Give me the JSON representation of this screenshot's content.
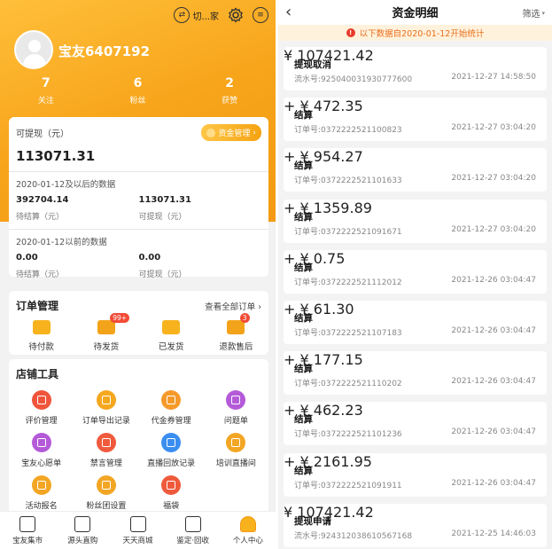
{
  "left": {
    "header": {
      "switch_label": "切...家"
    },
    "user": {
      "name": "宝友6407192"
    },
    "stats": [
      {
        "value": "7",
        "label": "关注"
      },
      {
        "value": "6",
        "label": "粉丝"
      },
      {
        "value": "2",
        "label": "获赞"
      }
    ],
    "wallet": {
      "withdrawable_label": "可提现（元）",
      "fund_manage_label": "资金管理",
      "withdrawable_amount": "113071.31",
      "after_label": "2020-01-12及以后的数据",
      "after_pending_value": "392704.14",
      "after_pending_label": "待结算（元）",
      "after_withdrawable_value": "113071.31",
      "after_withdrawable_label": "可提现（元）",
      "before_label": "2020-01-12以前的数据",
      "before_pending_value": "0.00",
      "before_pending_label": "待结算（元）",
      "before_withdrawable_value": "0.00",
      "before_withdrawable_label": "可提现（元）"
    },
    "orders": {
      "title": "订单管理",
      "view_all": "查看全部订单",
      "items": [
        {
          "label": "待付款",
          "badge": ""
        },
        {
          "label": "待发货",
          "badge": "99+"
        },
        {
          "label": "已发货",
          "badge": ""
        },
        {
          "label": "退款售后",
          "badge": "3"
        }
      ]
    },
    "tools": {
      "title": "店铺工具",
      "items": [
        {
          "label": "评价管理",
          "color": "#f0553c"
        },
        {
          "label": "订单导出记录",
          "color": "#f5a71e"
        },
        {
          "label": "代金券管理",
          "color": "#f59a2a"
        },
        {
          "label": "问题单",
          "color": "#b45ad8"
        },
        {
          "label": "宝友心愿单",
          "color": "#b45ad8"
        },
        {
          "label": "禁言管理",
          "color": "#ef5a3c"
        },
        {
          "label": "直播回放记录",
          "color": "#3b8ef0"
        },
        {
          "label": "培训直播间",
          "color": "#f2a624"
        },
        {
          "label": "活动报名",
          "color": "#f2a624"
        },
        {
          "label": "粉丝团设置",
          "color": "#f2a624"
        },
        {
          "label": "福袋",
          "color": "#ef5a3c"
        }
      ]
    },
    "tabs": [
      {
        "label": "宝友集市"
      },
      {
        "label": "源头直购"
      },
      {
        "label": "天天商城"
      },
      {
        "label": "鉴定·回收"
      },
      {
        "label": "个人中心"
      }
    ]
  },
  "right": {
    "title": "资金明细",
    "back_icon": "‹",
    "filter_label": "筛选",
    "notice": "以下数据自2020-01-12开始统计",
    "transactions": [
      {
        "name": "提现取消",
        "serial": "流水号:925040031930777600",
        "amount": "¥ 107421.42",
        "time": "2021-12-27 14:58:50"
      },
      {
        "name": "结算",
        "serial": "订单号:0372222521100823",
        "amount": "+ ¥ 472.35",
        "time": "2021-12-27 03:04:20"
      },
      {
        "name": "结算",
        "serial": "订单号:0372222521101633",
        "amount": "+ ¥ 954.27",
        "time": "2021-12-27 03:04:20"
      },
      {
        "name": "结算",
        "serial": "订单号:0372222521091671",
        "amount": "+ ¥ 1359.89",
        "time": "2021-12-27 03:04:20"
      },
      {
        "name": "结算",
        "serial": "订单号:0372222521112012",
        "amount": "+ ¥ 0.75",
        "time": "2021-12-26 03:04:47"
      },
      {
        "name": "结算",
        "serial": "订单号:0372222521107183",
        "amount": "+ ¥ 61.30",
        "time": "2021-12-26 03:04:47"
      },
      {
        "name": "结算",
        "serial": "订单号:0372222521110202",
        "amount": "+ ¥ 177.15",
        "time": "2021-12-26 03:04:47"
      },
      {
        "name": "结算",
        "serial": "订单号:0372222521101236",
        "amount": "+ ¥ 462.23",
        "time": "2021-12-26 03:04:47"
      },
      {
        "name": "结算",
        "serial": "订单号:0372222521091911",
        "amount": "+ ¥ 2161.95",
        "time": "2021-12-26 03:04:47"
      },
      {
        "name": "提现申请",
        "serial": "流水号:924312038610567168",
        "amount": "¥ 107421.42",
        "time": "2021-12-25 14:46:03"
      }
    ]
  }
}
